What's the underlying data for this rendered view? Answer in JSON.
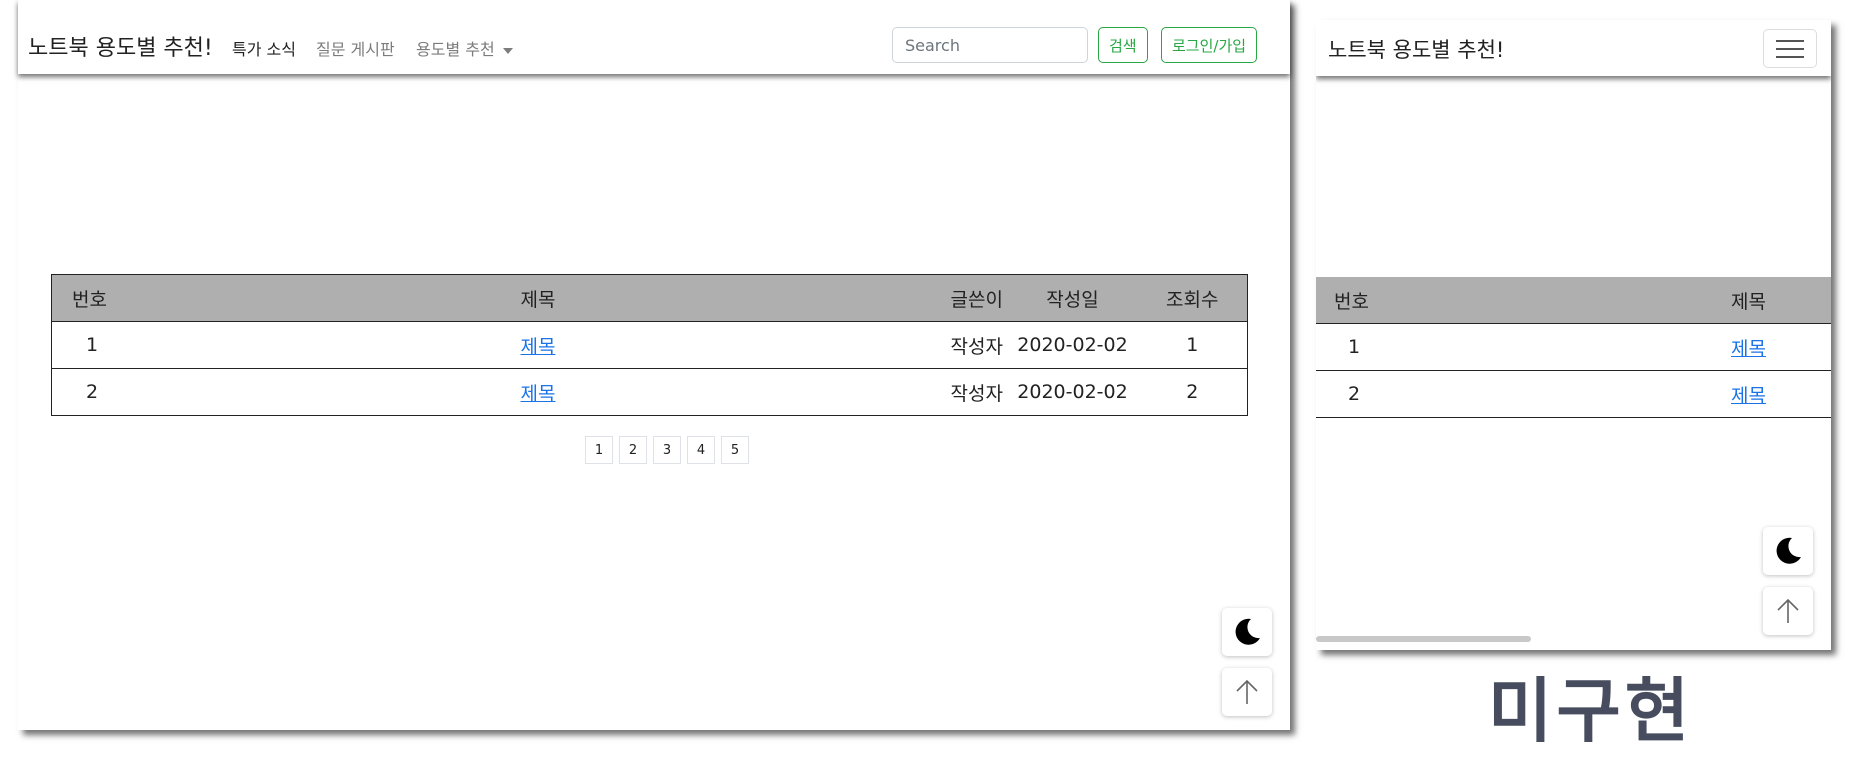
{
  "desktop": {
    "navbar": {
      "brand": "노트북 용도별 추천!",
      "links": [
        "특가 소식",
        "질문 게시판",
        "용도별 추천"
      ],
      "search_placeholder": "Search",
      "search_button": "검색",
      "login_button": "로그인/가입"
    },
    "table": {
      "headers": [
        "번호",
        "제목",
        "글쓴이",
        "작성일",
        "조회수"
      ],
      "rows": [
        {
          "no": "1",
          "title": "제목",
          "author": "작성자",
          "date": "2020-02-02",
          "views": "1"
        },
        {
          "no": "2",
          "title": "제목",
          "author": "작성자",
          "date": "2020-02-02",
          "views": "2"
        }
      ]
    },
    "pagination": [
      "1",
      "2",
      "3",
      "4",
      "5"
    ],
    "floating_buttons": {
      "theme": "moon-icon",
      "top": "arrow-up-icon"
    }
  },
  "mobile": {
    "navbar": {
      "brand": "노트북 용도별 추천!",
      "menu_icon": "hamburger-icon"
    },
    "table": {
      "headers": [
        "번호",
        "제목"
      ],
      "rows": [
        {
          "no": "1",
          "title": "제목"
        },
        {
          "no": "2",
          "title": "제목"
        }
      ]
    },
    "floating_buttons": {
      "theme": "moon-icon",
      "top": "arrow-up-icon"
    }
  },
  "note": "미구현",
  "colors": {
    "accent": "#28a745",
    "header_bg": "#afafaf",
    "link": "#1a73e8",
    "note": "#474d5e"
  }
}
